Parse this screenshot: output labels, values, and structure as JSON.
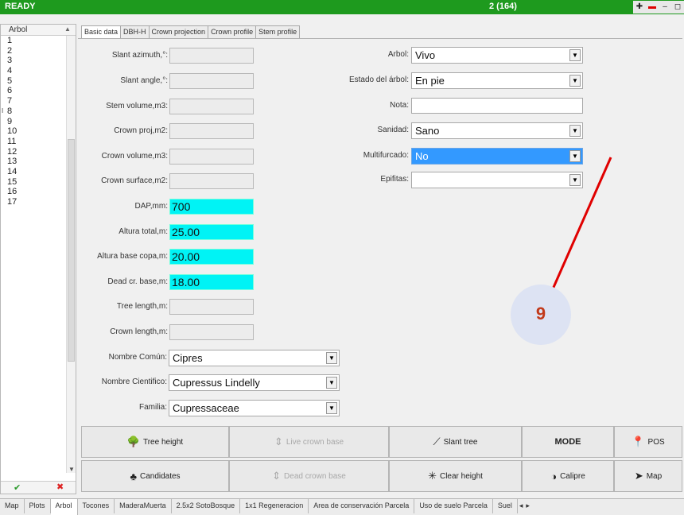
{
  "titlebar": {
    "status": "READY",
    "record": "2 (164)",
    "buttons": [
      {
        "name": "pin-icon",
        "glyph": "✚"
      },
      {
        "name": "flag-icon",
        "glyph": "▬"
      },
      {
        "name": "minimize-icon",
        "glyph": "–"
      },
      {
        "name": "restore-icon",
        "glyph": "◻"
      }
    ]
  },
  "left_list": {
    "header": "Arbol",
    "rows": [
      "1",
      "2",
      "3",
      "4",
      "5",
      "6",
      "7",
      "8",
      "9",
      "10",
      "11",
      "12",
      "13",
      "14",
      "15",
      "16",
      "17"
    ],
    "current_row": "8",
    "current_marker": "I"
  },
  "tabs": [
    "Basic data",
    "DBH-H",
    "Crown projection",
    "Crown profile",
    "Stem profile"
  ],
  "active_tab": "Basic data",
  "left_fields": [
    {
      "label": "Slant azimuth,°:",
      "value": "",
      "highlight": false
    },
    {
      "label": "Slant angle,°:",
      "value": "",
      "highlight": false
    },
    {
      "label": "Stem volume,m3:",
      "value": "",
      "highlight": false
    },
    {
      "label": "Crown proj,m2:",
      "value": "",
      "highlight": false
    },
    {
      "label": "Crown volume,m3:",
      "value": "",
      "highlight": false
    },
    {
      "label": "Crown surface,m2:",
      "value": "",
      "highlight": false
    },
    {
      "label": "DAP,mm:",
      "value": "700",
      "highlight": true
    },
    {
      "label": "Altura total,m:",
      "value": "25.00",
      "highlight": true
    },
    {
      "label": "Altura base copa,m:",
      "value": "20.00",
      "highlight": true
    },
    {
      "label": "Dead cr. base,m:",
      "value": "18.00",
      "highlight": true
    },
    {
      "label": "Tree length,m:",
      "value": "",
      "highlight": false
    },
    {
      "label": "Crown length,m:",
      "value": "",
      "highlight": false
    }
  ],
  "bottom_combos": [
    {
      "label": "Nombre Común:",
      "value": "Cipres"
    },
    {
      "label": "Nombre Cientifico:",
      "value": "Cupressus Lindelly"
    },
    {
      "label": "Familia:",
      "value": "Cupressaceae"
    }
  ],
  "right_fields": [
    {
      "label": "Arbol:",
      "value": "Vivo",
      "type": "combo",
      "selected": false
    },
    {
      "label": "Estado del árbol:",
      "value": "En pie",
      "type": "combo",
      "selected": false
    },
    {
      "label": "Nota:",
      "value": "",
      "type": "text",
      "selected": false
    },
    {
      "label": "Sanidad:",
      "value": "Sano",
      "type": "combo",
      "selected": false
    },
    {
      "label": "Multifurcado:",
      "value": "No",
      "type": "combo",
      "selected": true
    },
    {
      "label": "Epifitas:",
      "value": "",
      "type": "combo",
      "selected": false
    }
  ],
  "annotation": {
    "number": "9",
    "line_color": "#e00000"
  },
  "buttons": [
    {
      "label": "Tree height",
      "icon": "tree-height-icon",
      "glyph": "🌳",
      "disabled": false
    },
    {
      "label": "Live crown base",
      "icon": "live-crown-base-icon",
      "glyph": "⇕",
      "disabled": true
    },
    {
      "label": "Slant tree",
      "icon": "slant-tree-icon",
      "glyph": "⟋",
      "disabled": false
    },
    {
      "label": "MODE",
      "icon": "",
      "glyph": "",
      "disabled": false
    },
    {
      "label": "POS",
      "icon": "pos-pin-icon",
      "glyph": "📍",
      "disabled": false
    },
    {
      "label": "Candidates",
      "icon": "candidates-icon",
      "glyph": "♣",
      "disabled": false
    },
    {
      "label": "Dead crown base",
      "icon": "dead-crown-base-icon",
      "glyph": "⇕",
      "disabled": true
    },
    {
      "label": "Clear height",
      "icon": "clear-height-icon",
      "glyph": "✳",
      "disabled": false
    },
    {
      "label": "Calipre",
      "icon": "caliper-icon",
      "glyph": "◑",
      "disabled": false
    },
    {
      "label": "Map",
      "icon": "map-icon",
      "glyph": "➤",
      "disabled": false
    }
  ],
  "bottom_tabs": [
    "Map",
    "Plots",
    "Arbol",
    "Tocones",
    "MaderaMuerta",
    "2.5x2 SotoBosque",
    "1x1 Regeneracion",
    "Area de conservación Parcela",
    "Uso de suelo Parcela",
    "Suel"
  ],
  "active_bottom_tab": "Arbol",
  "bottom_nav": [
    "◂",
    "▸"
  ],
  "colors": {
    "titlebar": "#1e9a1e",
    "highlight_field": "#00f3f5",
    "selected_combo": "#3399ff"
  }
}
